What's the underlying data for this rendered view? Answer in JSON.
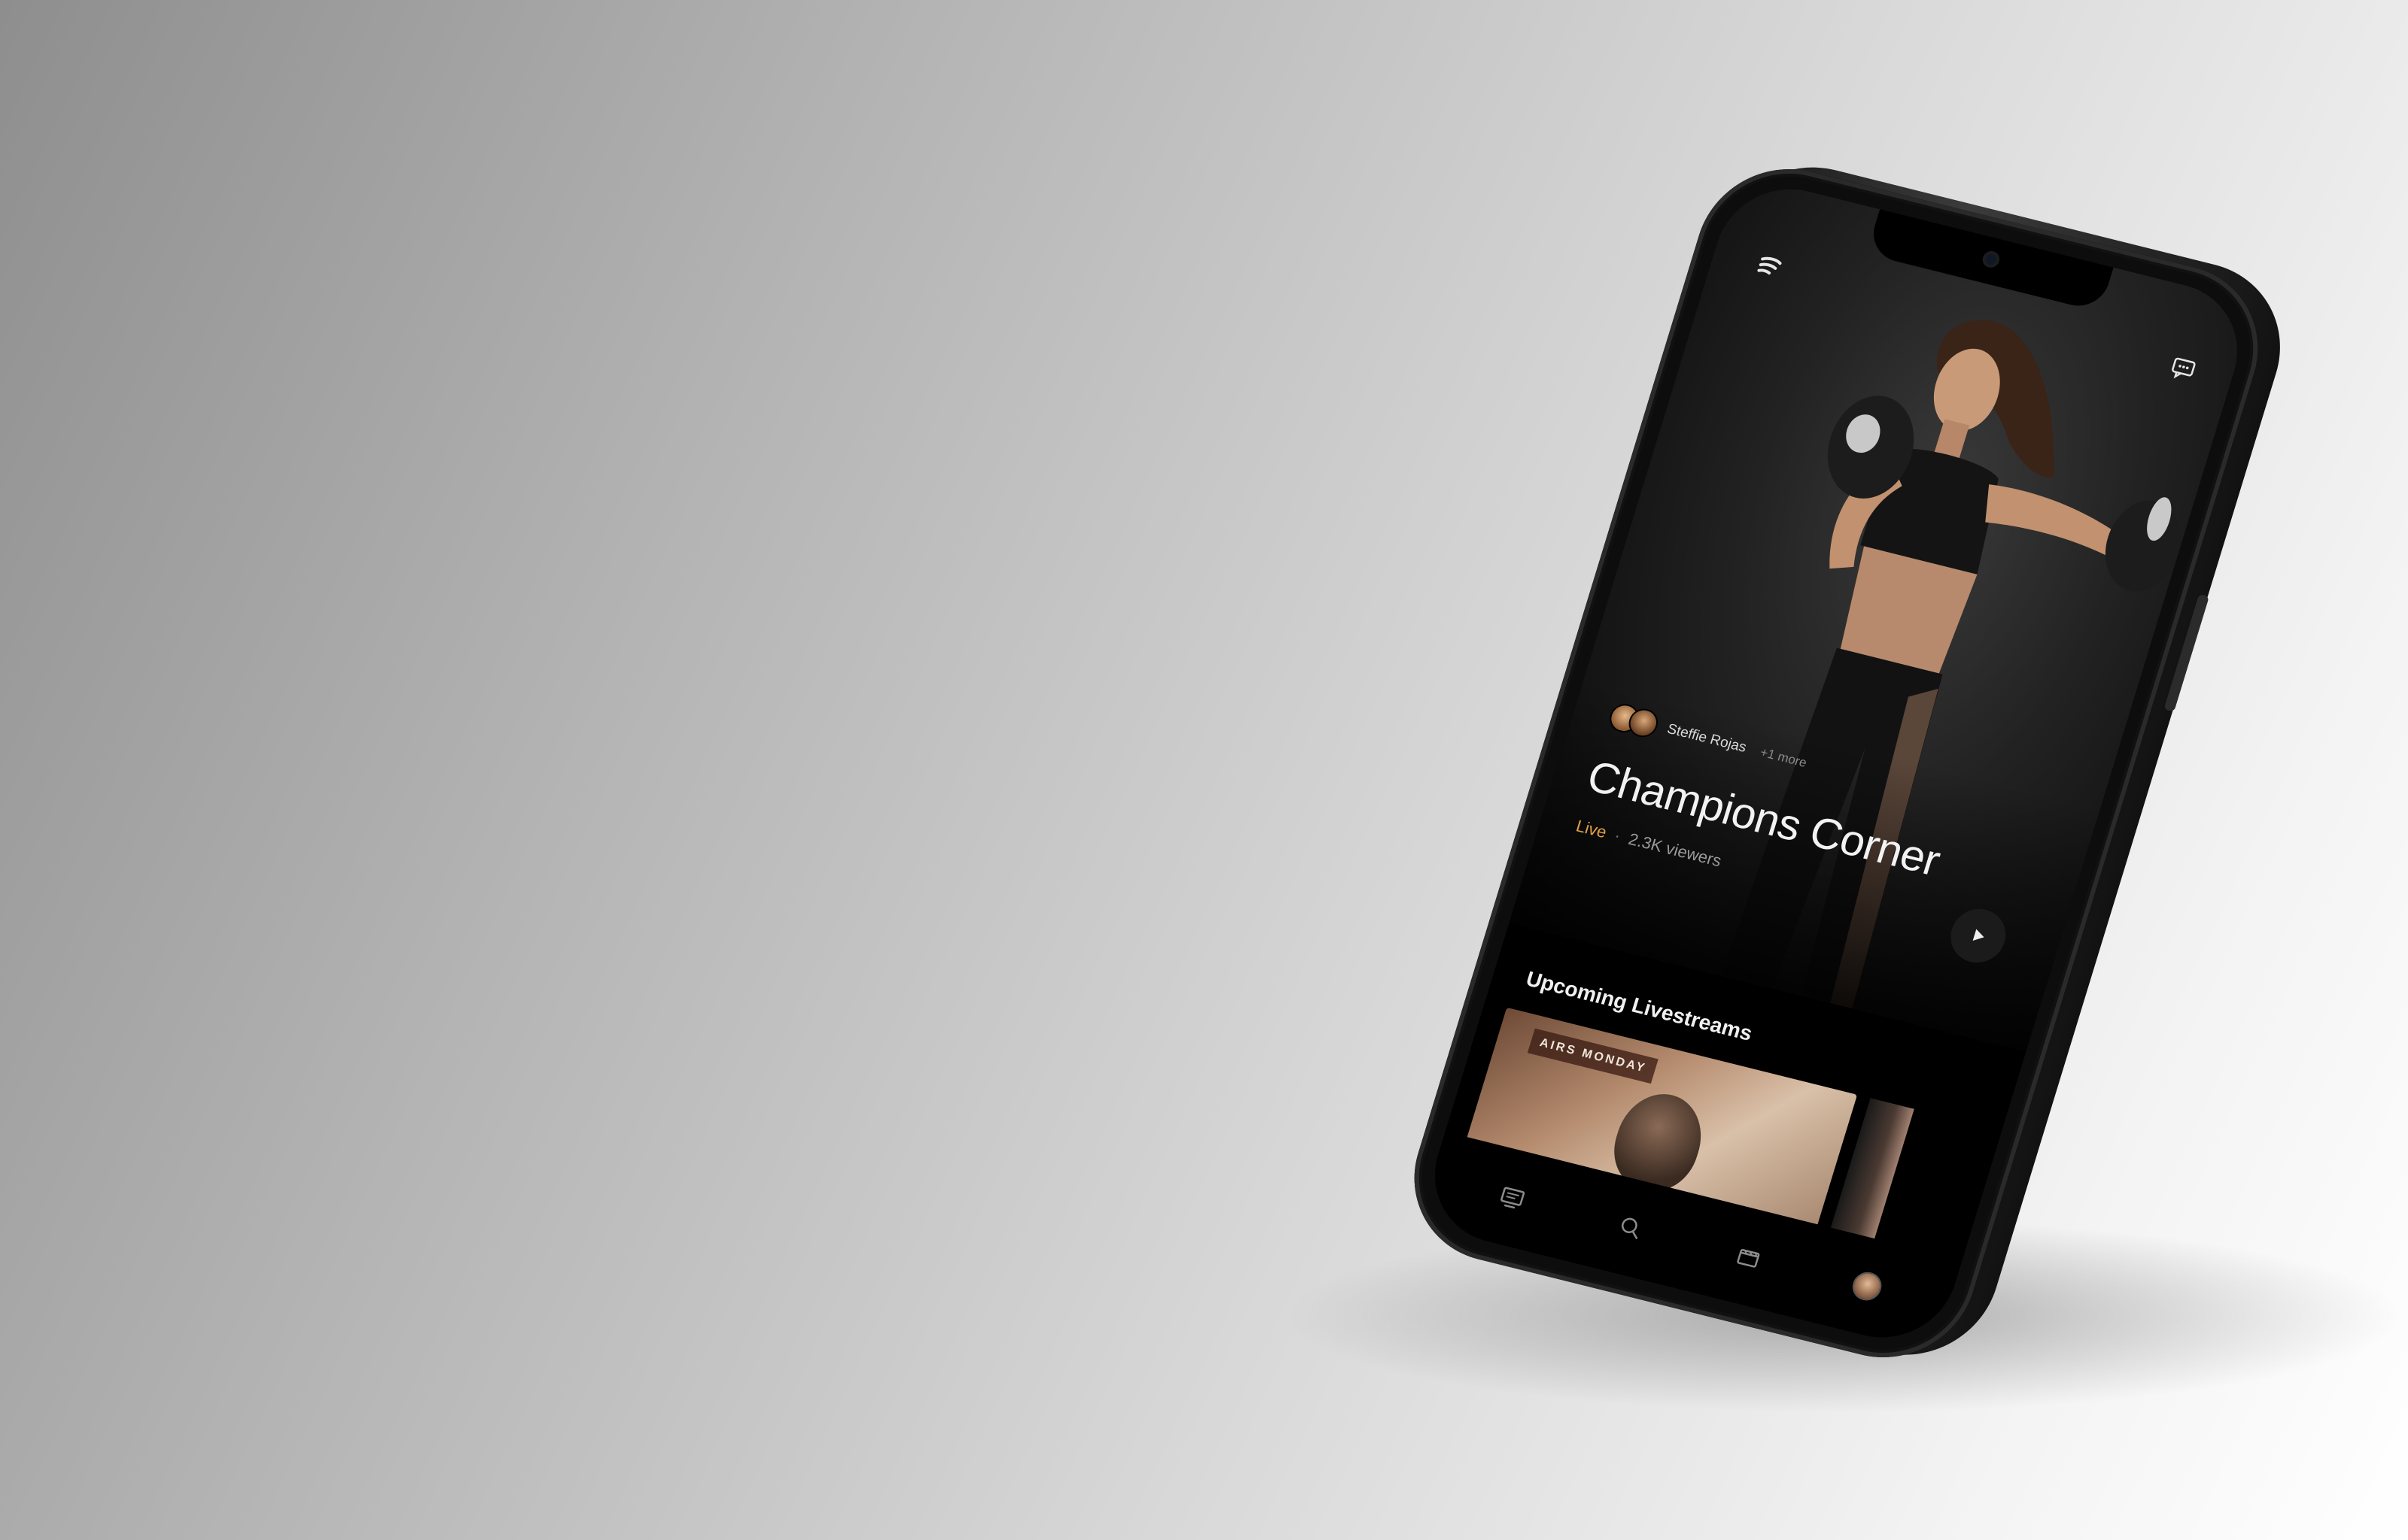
{
  "app": {
    "hero": {
      "hosts": {
        "name": "Steffie Rojas",
        "more": "+1 more"
      },
      "title": "Champions Corner",
      "status": {
        "live": "Live",
        "separator": "·",
        "viewers": "2.3K viewers"
      }
    },
    "upcoming": {
      "section_title": "Upcoming Livestreams",
      "cards": [
        {
          "badge": "AIRS MONDAY"
        }
      ]
    },
    "tabbar": {
      "items": [
        "tv-icon",
        "search-icon",
        "clapperboard-icon",
        "profile-avatar"
      ]
    },
    "colors": {
      "live_accent": "#e2a24a",
      "screen_bg": "#000000",
      "background_light": "#ffffff",
      "background_dark": "#8e8e8e"
    }
  }
}
